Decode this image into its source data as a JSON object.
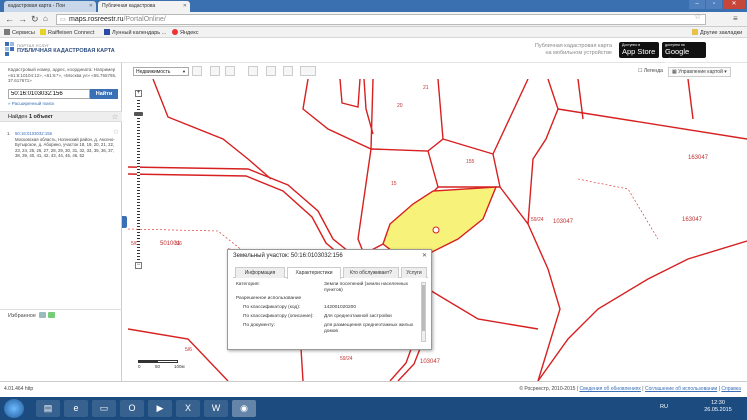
{
  "browser": {
    "tabs": [
      {
        "label": "кадастровая карта - Пои"
      },
      {
        "label": "Публичная кадастрова"
      }
    ],
    "address": {
      "host": "maps.rosreestr.ru",
      "path": "/PortalOnline/"
    },
    "bookmarks": [
      "Сервисы",
      "Raiffeisen Connect",
      "Лунный календарь ...",
      "Яндекс"
    ],
    "other_bookmarks": "Другие закладки"
  },
  "portal": {
    "small_title": "ПОРТАЛ УСЛУГ",
    "big_title": "ПУБЛИЧНАЯ КАДАСТРОВАЯ КАРТА",
    "mobile_line1": "Публичная кадастровая карта",
    "mobile_line2": "на мобильном устройстве",
    "appstore_small": "Доступно в",
    "appstore_big": "App Store",
    "gplay_small": "доступно на",
    "gplay_big": "Google play"
  },
  "sidebar": {
    "search_label": "Кадастровый номер, адрес, координата: Например «61:6:10104:12», «61:6:*», «Москва ул» «55.755765, 37.617671»",
    "search_value": "50:16:0103032:156",
    "search_button": "Найти",
    "advanced": "» Расширенный поиск",
    "found_prefix": "Найден",
    "found_count": "1 объект",
    "result": {
      "number": "1.",
      "link": "50:16:0103032:156",
      "address": "Московская область, Ногинский район, д. Аксено-Бутырское, д. Аборино, участок 18, 19, 20, 21, 22, 23, 24, 25, 26, 27, 28, 29, 30, 31, 32, 33, 35, 36, 37, 38, 39, 40, 41, 42, 43, 44, 45, 46, 52"
    },
    "favorites": "Избранное"
  },
  "map_toolbar": {
    "layer": "Недвижимость",
    "legend": "Легенда",
    "control": "Управление картой"
  },
  "map": {
    "labels": [
      "163047",
      "163047",
      "59/24",
      "103047",
      "501001",
      "5/6",
      "5/6",
      "5/6",
      "155",
      "15",
      "20",
      "21",
      "59/24",
      "103047"
    ],
    "scale": [
      "0",
      "50",
      "100м"
    ]
  },
  "popup": {
    "title": "Земельный участок: 50:16:0103032:156",
    "tabs": [
      "Информация",
      "Характеристики",
      "Кто обслуживает?",
      "Услуги"
    ],
    "rows": [
      {
        "k": "Категория:",
        "v": "Земли поселений (земли населенных пунктов)"
      },
      {
        "k": "Разрешенное использование",
        "v": ""
      },
      {
        "k": "По классификатору (код):",
        "v": "142001020200"
      },
      {
        "k": "По классификатору (описание):",
        "v": "Для среднеэтажной застройки"
      },
      {
        "k": "По документу:",
        "v": "для размещения среднеэтажных жилых домов"
      }
    ]
  },
  "status": {
    "version": "4.01.464 http",
    "copyright": "© Росреестр, 2010-2015",
    "links": [
      "Сведения об обновлениях",
      "Соглашение об использовании",
      "Справка"
    ]
  },
  "taskbar": {
    "lang": "RU",
    "time": "12:30",
    "date": "26.05.2015"
  },
  "colors": {
    "parcel_fill": "#f7f27a",
    "boundary": "#d72020",
    "accent": "#3b6fb6"
  }
}
